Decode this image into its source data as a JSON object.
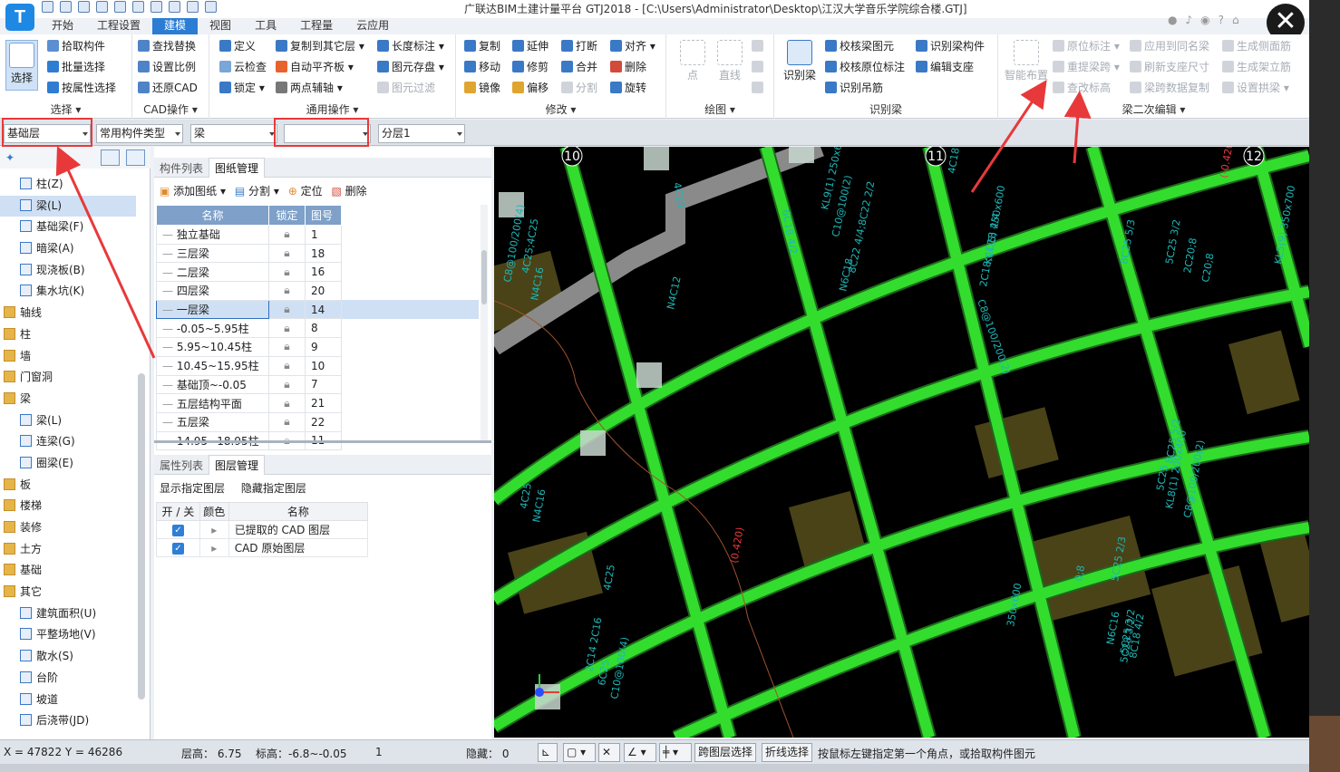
{
  "window": {
    "title": "广联达BIM土建计量平台 GTJ2018 - [C:\\Users\\Administrator\\Desktop\\江汉大学音乐学院综合楼.GTJ]",
    "logo_letter": "T"
  },
  "menu": {
    "tabs": [
      "开始",
      "工程设置",
      "建模",
      "视图",
      "工具",
      "工程量",
      "云应用"
    ],
    "active": "建模"
  },
  "ribbon": {
    "select": {
      "big": "选择",
      "items": [
        "拾取构件",
        "批量选择",
        "按属性选择"
      ],
      "label": "选择"
    },
    "cad": {
      "items": [
        "查找替换",
        "设置比例",
        "还原CAD"
      ],
      "label": "CAD操作"
    },
    "common": {
      "col1": [
        "定义",
        "云检查",
        "锁定"
      ],
      "col2": [
        "复制到其它层",
        "自动平齐板",
        "两点辅轴"
      ],
      "col3": [
        "长度标注",
        "图元存盘",
        "图元过滤"
      ],
      "label": "通用操作"
    },
    "modify": {
      "col1": [
        "复制",
        "移动",
        "镜像"
      ],
      "col2": [
        "延伸",
        "修剪",
        "偏移"
      ],
      "col3": [
        "打断",
        "合并",
        "分割"
      ],
      "col4": [
        "对齐",
        "删除",
        "旋转"
      ],
      "label": "修改"
    },
    "draw": {
      "items": [
        "点",
        "直线"
      ],
      "label": "绘图"
    },
    "identify": {
      "big": "识别梁",
      "items": [
        "校核梁图元",
        "校核原位标注",
        "识别吊筋"
      ],
      "col2": [
        "识别梁构件",
        "编辑支座"
      ],
      "label": "识别梁"
    },
    "secondary": {
      "big": "智能布置",
      "col1": [
        "原位标注",
        "重提梁跨",
        "查改标高"
      ],
      "col2": [
        "应用到同名梁",
        "刷新支座尺寸",
        "梁跨数据复制"
      ],
      "col3": [
        "生成侧面筋",
        "生成架立筋",
        "设置拱梁"
      ],
      "label": "梁二次编辑"
    }
  },
  "toolbar2": {
    "floor": "基础层",
    "comp_type": "常用构件类型",
    "comp": "梁",
    "blank": "",
    "layer": "分层1"
  },
  "tree": [
    {
      "label": "柱(Z)",
      "level": 1,
      "icon": "column-icon"
    },
    {
      "label": "梁(L)",
      "level": 1,
      "icon": "beam-icon",
      "selected": true
    },
    {
      "label": "基础梁(F)",
      "level": 1,
      "icon": "foundation-beam-icon"
    },
    {
      "label": "暗梁(A)",
      "level": 1,
      "icon": "hidden-beam-icon"
    },
    {
      "label": "现浇板(B)",
      "level": 1,
      "icon": "slab-icon"
    },
    {
      "label": "集水坑(K)",
      "level": 1,
      "icon": "sump-icon"
    },
    {
      "label": "轴线",
      "level": 0,
      "icon": "folder-icon"
    },
    {
      "label": "柱",
      "level": 0,
      "icon": "folder-icon"
    },
    {
      "label": "墙",
      "level": 0,
      "icon": "folder-icon"
    },
    {
      "label": "门窗洞",
      "level": 0,
      "icon": "folder-icon"
    },
    {
      "label": "梁",
      "level": 0,
      "icon": "folder-icon"
    },
    {
      "label": "梁(L)",
      "level": 1,
      "icon": "beam-icon"
    },
    {
      "label": "连梁(G)",
      "level": 1,
      "icon": "coupling-beam-icon"
    },
    {
      "label": "圈梁(E)",
      "level": 1,
      "icon": "ring-beam-icon"
    },
    {
      "label": "板",
      "level": 0,
      "icon": "folder-icon"
    },
    {
      "label": "楼梯",
      "level": 0,
      "icon": "folder-icon"
    },
    {
      "label": "装修",
      "level": 0,
      "icon": "folder-icon"
    },
    {
      "label": "土方",
      "level": 0,
      "icon": "folder-icon"
    },
    {
      "label": "基础",
      "level": 0,
      "icon": "folder-icon"
    },
    {
      "label": "其它",
      "level": 0,
      "icon": "folder-icon"
    },
    {
      "label": "建筑面积(U)",
      "level": 1,
      "icon": "area-icon"
    },
    {
      "label": "平整场地(V)",
      "level": 1,
      "icon": "leveling-icon"
    },
    {
      "label": "散水(S)",
      "level": 1,
      "icon": "apron-icon"
    },
    {
      "label": "台阶",
      "level": 1,
      "icon": "steps-icon"
    },
    {
      "label": "坡道",
      "level": 1,
      "icon": "ramp-icon"
    },
    {
      "label": "后浇带(JD)",
      "level": 1,
      "icon": "post-pour-icon"
    }
  ],
  "mid": {
    "tabs_top": [
      "构件列表",
      "图纸管理"
    ],
    "tools_top": [
      "添加图纸",
      "分割",
      "定位",
      "删除"
    ],
    "table_headers": [
      "名称",
      "锁定",
      "图号"
    ],
    "rows": [
      [
        "独立基础",
        "1"
      ],
      [
        "三层梁",
        "18"
      ],
      [
        "二层梁",
        "16"
      ],
      [
        "四层梁",
        "20"
      ],
      [
        "一层梁",
        "14"
      ],
      [
        "-0.05~5.95柱",
        "8"
      ],
      [
        "5.95~10.45柱",
        "9"
      ],
      [
        "10.45~15.95柱",
        "10"
      ],
      [
        "基础顶~-0.05",
        "7"
      ],
      [
        "五层结构平面",
        "21"
      ],
      [
        "五层梁",
        "22"
      ],
      [
        "14.95~18.95柱",
        "11"
      ]
    ],
    "selected_row": "一层梁",
    "tabs_bottom": [
      "属性列表",
      "图层管理"
    ],
    "tools_bottom": [
      "显示指定图层",
      "隐藏指定图层"
    ],
    "layer_headers": [
      "开 / 关",
      "颜色",
      "名称"
    ],
    "layers": [
      "已提取的 CAD 图层",
      "CAD 原始图层"
    ]
  },
  "canvas": {
    "axis_labels": [
      "10",
      "11",
      "12"
    ],
    "annotations": [
      "4C18",
      "6C18 4/2",
      "KL9(1) 250x600",
      "C10@100(2)",
      "8C22 4/4;8C22 2/2",
      "N6C18",
      "KL1(5) 250x600",
      "C8@100/200(2)",
      "2C18;4C18 4/4",
      "N4C12",
      "8C25 5/3",
      "5C25 3/2",
      "2C20;8",
      "C20;8",
      "KL5(9) 350x700",
      "C8@100/200(4)",
      "4C25;4C25",
      "N4C16",
      "(0.420)",
      "4C25",
      "N4C16",
      "0;8",
      "8C25 5/2",
      "5C25",
      "KL8(1) 200x400",
      "C8@100/200(2)",
      "2C14 2C16",
      "6C25",
      "C10@100(4)",
      "N6C16",
      "5C25 3/2",
      "8C18 4/2",
      "(-0.420)",
      "4C18",
      "350x600",
      "5C28 3/2",
      "5C25 2/3",
      "4C25"
    ]
  },
  "status": {
    "coords": "X = 47822 Y = 46286",
    "floor_h": "层高： 6.75",
    "elev": "标高：-6.8~-0.05",
    "count": "1",
    "hidden": "隐藏： 0",
    "btn_cross": "跨图层选择",
    "btn_poly": "折线选择",
    "hint": "按鼠标左键指定第一个角点，或拾取构件图元"
  },
  "colors": {
    "accent": "#2b7cd3",
    "beam": "#33dd2e",
    "annotation_red": "#e8393a",
    "cad_text": "#1fb6b6"
  }
}
